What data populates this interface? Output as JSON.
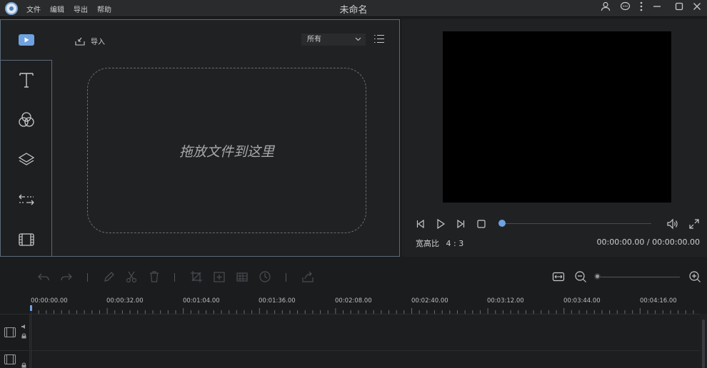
{
  "window": {
    "title": "未命名",
    "menu": [
      "文件",
      "编辑",
      "导出",
      "帮助"
    ]
  },
  "media": {
    "import_label": "导入",
    "filter_selected": "所有",
    "dropzone_text": "拖放文件到这里"
  },
  "preview": {
    "aspect_label": "宽高比",
    "aspect_value": "4 : 3",
    "timecode": "00:00:00.00 / 00:00:00.00",
    "accent_color": "#6fa2e0"
  },
  "timeline": {
    "ruler": [
      "00:00:00.00",
      "00:00:32.00",
      "00:01:04.00",
      "00:01:36.00",
      "00:02:08.00",
      "00:02:40.00",
      "00:03:12.00",
      "00:03:44.00",
      "00:04:16.00"
    ]
  }
}
